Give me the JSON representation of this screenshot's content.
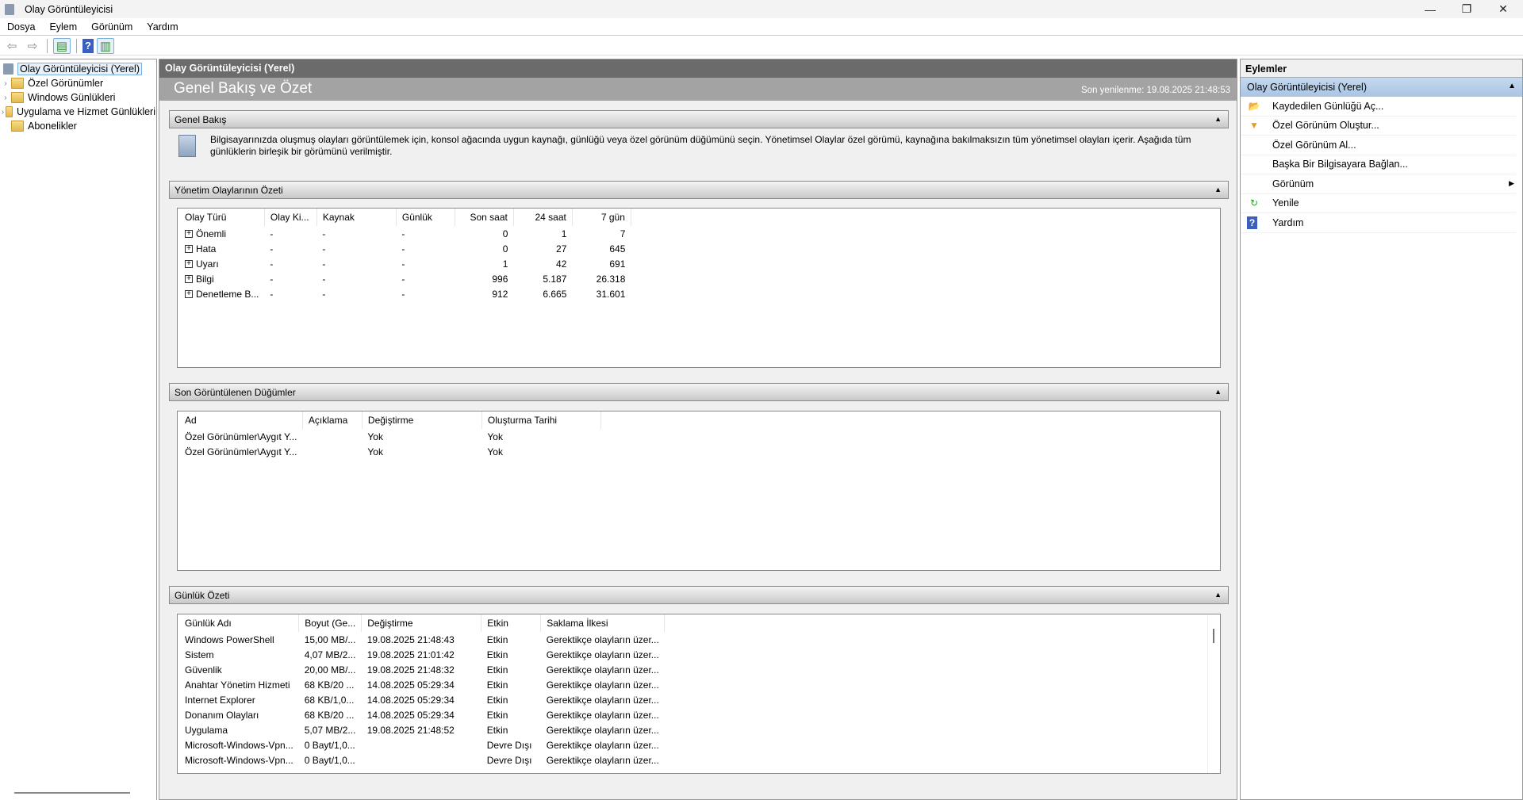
{
  "window": {
    "title": "Olay Görüntüleyicisi",
    "minimize": "—",
    "maximize": "❐",
    "close": "✕"
  },
  "menu": [
    "Dosya",
    "Eylem",
    "Görünüm",
    "Yardım"
  ],
  "tree": [
    {
      "label": "Olay Görüntüleyicisi (Yerel)"
    },
    {
      "label": "Özel Görünümler"
    },
    {
      "label": "Windows Günlükleri"
    },
    {
      "label": "Uygulama ve Hizmet Günlükleri"
    },
    {
      "label": "Abonelikler"
    }
  ],
  "content": {
    "header": "Olay Görüntüleyicisi (Yerel)",
    "title": "Genel Bakış ve Özet",
    "refreshed": "Son yenilenme: 19.08.2025 21:48:53"
  },
  "overview": {
    "title": "Genel Bakış",
    "text": "Bilgisayarınızda oluşmuş olayları görüntülemek için, konsol ağacında uygun kaynağı, günlüğü veya özel görünüm düğümünü seçin. Yönetimsel Olaylar özel görümü, kaynağına bakılmaksızın tüm yönetimsel olayları içerir. Aşağıda tüm günlüklerin birleşik bir görümünü verilmiştir."
  },
  "admin": {
    "title": "Yönetim Olaylarının Özeti",
    "columns": [
      "Olay Türü",
      "Olay Ki...",
      "Kaynak",
      "Günlük",
      "Son saat",
      "24 saat",
      "7 gün"
    ],
    "rows": [
      [
        "Önemli",
        "-",
        "-",
        "-",
        "0",
        "1",
        "7"
      ],
      [
        "Hata",
        "-",
        "-",
        "-",
        "0",
        "27",
        "645"
      ],
      [
        "Uyarı",
        "-",
        "-",
        "-",
        "1",
        "42",
        "691"
      ],
      [
        "Bilgi",
        "-",
        "-",
        "-",
        "996",
        "5.187",
        "26.318"
      ],
      [
        "Denetleme B...",
        "-",
        "-",
        "-",
        "912",
        "6.665",
        "31.601"
      ]
    ]
  },
  "recent": {
    "title": "Son Görüntülenen Düğümler",
    "columns": [
      "Ad",
      "Açıklama",
      "Değiştirme",
      "Oluşturma Tarihi"
    ],
    "rows": [
      [
        "Özel Görünümler\\Aygıt Y...",
        "",
        "Yok",
        "Yok"
      ],
      [
        "Özel Görünümler\\Aygıt Y...",
        "",
        "Yok",
        "Yok"
      ]
    ]
  },
  "logs": {
    "title": "Günlük Özeti",
    "columns": [
      "Günlük Adı",
      "Boyut (Ge...",
      "Değiştirme",
      "Etkin",
      "Saklama İlkesi"
    ],
    "rows": [
      [
        "Windows PowerShell",
        "15,00 MB/...",
        "19.08.2025 21:48:43",
        "Etkin",
        "Gerektikçe olayların üzer..."
      ],
      [
        "Sistem",
        "4,07 MB/2...",
        "19.08.2025 21:01:42",
        "Etkin",
        "Gerektikçe olayların üzer..."
      ],
      [
        "Güvenlik",
        "20,00 MB/...",
        "19.08.2025 21:48:32",
        "Etkin",
        "Gerektikçe olayların üzer..."
      ],
      [
        "Anahtar Yönetim Hizmeti",
        "68 KB/20 ...",
        "14.08.2025 05:29:34",
        "Etkin",
        "Gerektikçe olayların üzer..."
      ],
      [
        "Internet Explorer",
        "68 KB/1,0...",
        "14.08.2025 05:29:34",
        "Etkin",
        "Gerektikçe olayların üzer..."
      ],
      [
        "Donanım Olayları",
        "68 KB/20 ...",
        "14.08.2025 05:29:34",
        "Etkin",
        "Gerektikçe olayların üzer..."
      ],
      [
        "Uygulama",
        "5,07 MB/2...",
        "19.08.2025 21:48:52",
        "Etkin",
        "Gerektikçe olayların üzer..."
      ],
      [
        "Microsoft-Windows-Vpn...",
        "0 Bayt/1,0...",
        "",
        "Devre Dışı",
        "Gerektikçe olayların üzer..."
      ],
      [
        "Microsoft-Windows-Vpn...",
        "0 Bayt/1,0...",
        "",
        "Devre Dışı",
        "Gerektikçe olayların üzer..."
      ]
    ]
  },
  "actions": {
    "title": "Eylemler",
    "section": "Olay Görüntüleyicisi (Yerel)",
    "items": [
      {
        "label": "Kaydedilen Günlüğü Aç...",
        "icon": "open-folder-icon"
      },
      {
        "label": "Özel Görünüm Oluştur...",
        "icon": "filter-icon"
      },
      {
        "label": "Özel Görünüm Al...",
        "icon": ""
      },
      {
        "label": "Başka Bir Bilgisayara Bağlan...",
        "icon": ""
      },
      {
        "label": "Görünüm",
        "icon": ""
      },
      {
        "label": "Yenile",
        "icon": "refresh-icon"
      },
      {
        "label": "Yardım",
        "icon": "help-icon"
      }
    ]
  }
}
